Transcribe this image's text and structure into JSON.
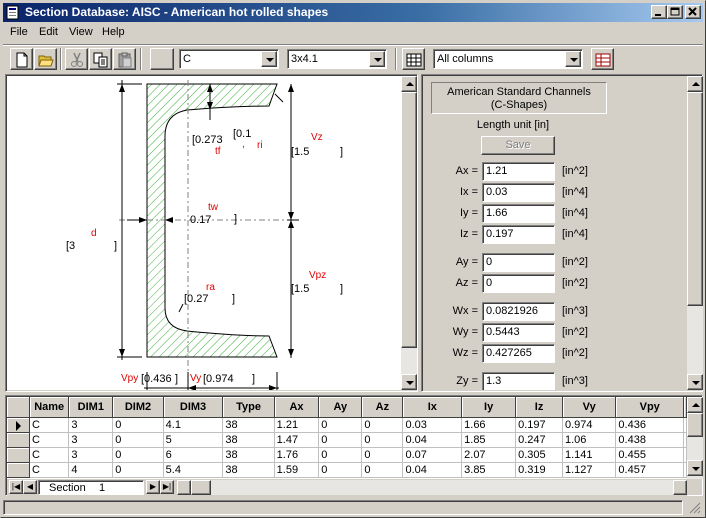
{
  "window": {
    "title": "Section Database: AISC - American hot rolled shapes"
  },
  "menu": {
    "file": "File",
    "edit": "Edit",
    "view": "View",
    "help": "Help"
  },
  "toolbar": {
    "shape_value": "C",
    "size_value": "3x4.1",
    "columns_value": "All columns"
  },
  "drawing": {
    "tf_value": "[0.273",
    "ri_value": "[0.1",
    "tw_value": "0.17",
    "d_value": "[3",
    "ra_value": "[0.27",
    "vz_value": "[1.5",
    "vpz_value": "[1.5",
    "vpy_value": "[0.436",
    "vy_value": "[0.974",
    "label_tf": "tf",
    "label_ri": "ri",
    "label_tw": "tw",
    "label_d": "d",
    "label_ra": "ra",
    "label_vz": "Vz",
    "label_vpz": "Vpz",
    "label_vpy": "Vpy",
    "label_vy": "Vy",
    "bracket": "]"
  },
  "properties": {
    "family_line1": "American Standard Channels",
    "family_line2": "(C-Shapes)",
    "length_unit": "Length unit  [in]",
    "save_label": "Save",
    "rows": [
      {
        "label": "Ax =",
        "value": "1.21",
        "unit": "[in^2]"
      },
      {
        "label": "Ix =",
        "value": "0.03",
        "unit": "[in^4]"
      },
      {
        "label": "Iy =",
        "value": "1.66",
        "unit": "[in^4]"
      },
      {
        "label": "Iz =",
        "value": "0.197",
        "unit": "[in^4]"
      },
      {
        "label": "Ay =",
        "value": "0",
        "unit": "[in^2]"
      },
      {
        "label": "Az =",
        "value": "0",
        "unit": "[in^2]"
      },
      {
        "label": "Wx =",
        "value": "0.0821926",
        "unit": "[in^3]"
      },
      {
        "label": "Wy =",
        "value": "0.5443",
        "unit": "[in^2]"
      },
      {
        "label": "Wz =",
        "value": "0.427265",
        "unit": "[in^2]"
      },
      {
        "label": "Zy =",
        "value": "1.3",
        "unit": "[in^3]"
      }
    ]
  },
  "grid": {
    "columns": [
      "Name",
      "DIM1",
      "DIM2",
      "DIM3",
      "Type",
      "Ax",
      "Ay",
      "Az",
      "Ix",
      "Iy",
      "Iz",
      "Vy",
      "Vpy"
    ],
    "rows": [
      [
        "C",
        "3",
        "0",
        "4.1",
        "38",
        "1.21",
        "0",
        "0",
        "0.03",
        "1.66",
        "0.197",
        "0.974",
        "0.436"
      ],
      [
        "C",
        "3",
        "0",
        "5",
        "38",
        "1.47",
        "0",
        "0",
        "0.04",
        "1.85",
        "0.247",
        "1.06",
        "0.438"
      ],
      [
        "C",
        "3",
        "0",
        "6",
        "38",
        "1.76",
        "0",
        "0",
        "0.07",
        "2.07",
        "0.305",
        "1.141",
        "0.455"
      ],
      [
        "C",
        "4",
        "0",
        "5.4",
        "38",
        "1.59",
        "0",
        "0",
        "0.04",
        "3.85",
        "0.319",
        "1.127",
        "0.457"
      ]
    ],
    "sheet_label": "Section",
    "sheet_number": "1"
  }
}
